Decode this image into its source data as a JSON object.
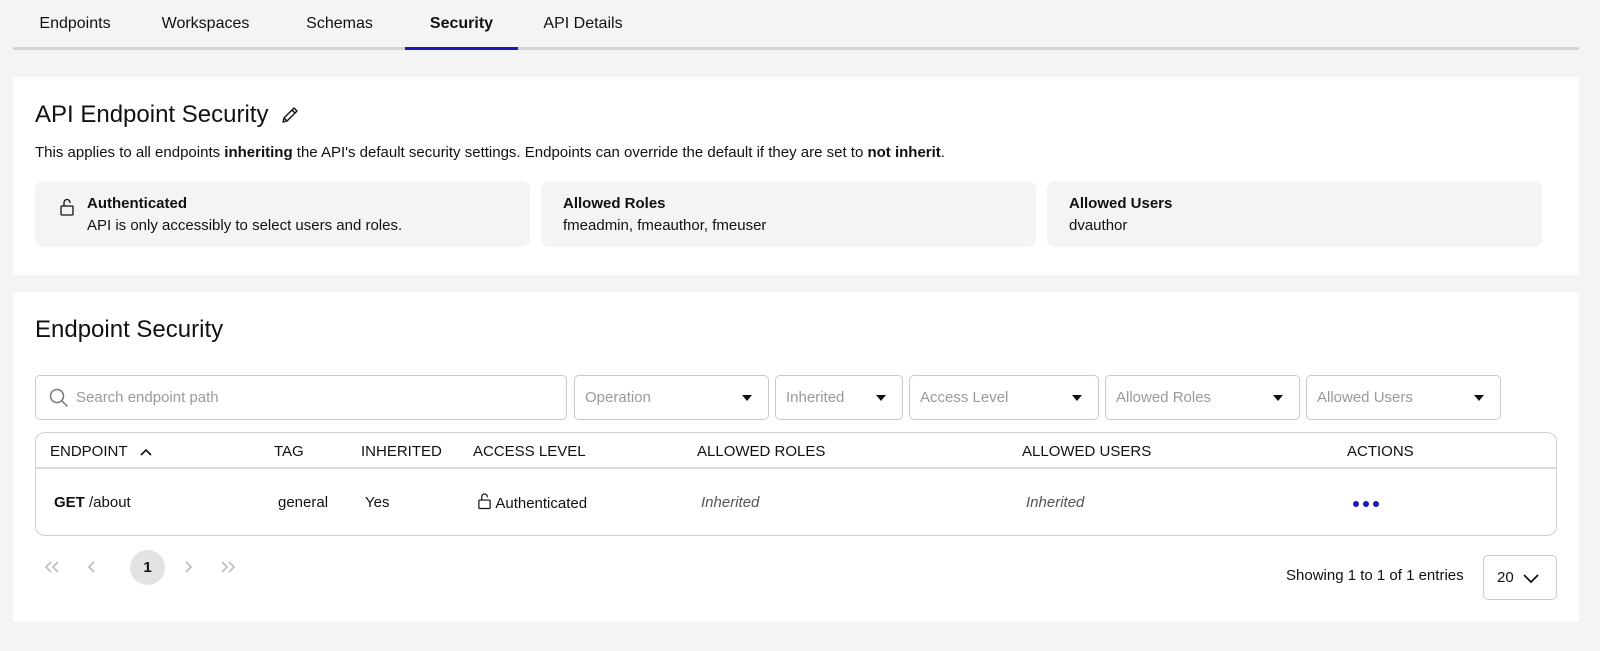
{
  "tabs": [
    {
      "label": "Endpoints"
    },
    {
      "label": "Workspaces"
    },
    {
      "label": "Schemas"
    },
    {
      "label": "Security"
    },
    {
      "label": "API Details"
    }
  ],
  "active_tab": "Security",
  "api_security": {
    "title": "API Endpoint Security",
    "desc_part1": "This applies to all endpoints ",
    "desc_bold1": "inheriting",
    "desc_part2": " the API's default security settings. Endpoints can override the default if they are set to ",
    "desc_bold2": "not inherit",
    "desc_part3": ".",
    "auth": {
      "label": "Authenticated",
      "value": "API is only accessibly to select users and roles."
    },
    "roles": {
      "label": "Allowed Roles",
      "value": "fmeadmin, fmeauthor, fmeuser"
    },
    "users": {
      "label": "Allowed Users",
      "value": "dvauthor"
    }
  },
  "endpoint_security": {
    "title": "Endpoint Security",
    "filters": {
      "search_placeholder": "Search endpoint path",
      "operation": "Operation",
      "inherited": "Inherited",
      "access_level": "Access Level",
      "allowed_roles": "Allowed Roles",
      "allowed_users": "Allowed Users"
    },
    "columns": {
      "endpoint": "Endpoint",
      "tag": "Tag",
      "inherited": "Inherited",
      "access_level": "Access Level",
      "allowed_roles": "Allowed Roles",
      "allowed_users": "Allowed Users",
      "actions": "Actions"
    },
    "rows": [
      {
        "method": "GET",
        "path": "/about",
        "tag": "general",
        "inherited": "Yes",
        "access_level": "Authenticated",
        "allowed_roles": "Inherited",
        "allowed_users": "Inherited"
      }
    ],
    "pagination": {
      "current_page": "1",
      "showing": "Showing 1 to 1 of 1 entries",
      "page_size": "20"
    }
  },
  "colors": {
    "accent": "#1a1ab8",
    "background": "#f4f4f4",
    "card": "#ffffff"
  }
}
